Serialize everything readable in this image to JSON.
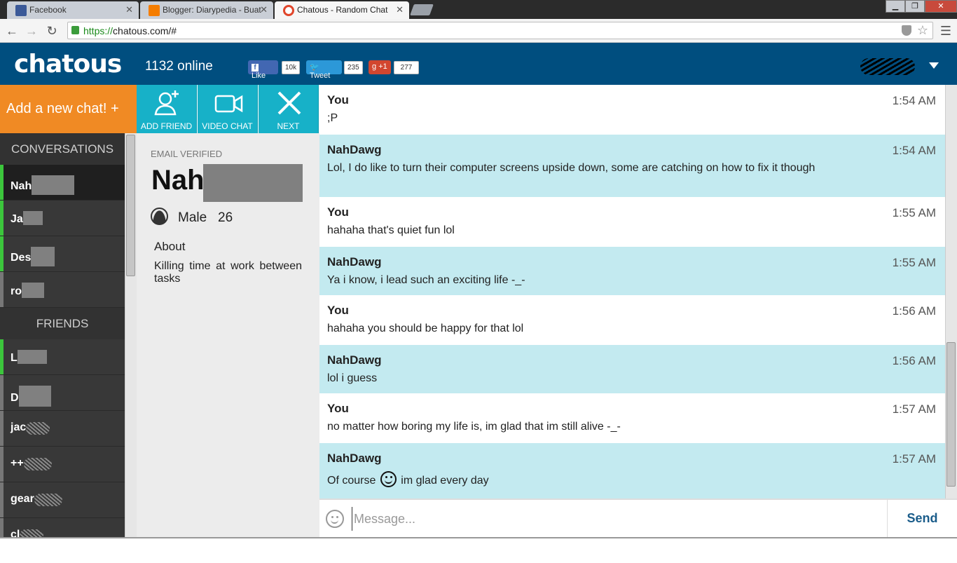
{
  "browser": {
    "tabs": [
      {
        "label": "Facebook",
        "favicon_color": "#3b5998"
      },
      {
        "label": "Blogger: Diarypedia - Buat",
        "favicon_color": "#f57d00"
      },
      {
        "label": "Chatous - Random Chat",
        "favicon_color": "#e0452a",
        "active": true
      }
    ],
    "url_scheme": "https://",
    "url_rest": "chatous.com/#"
  },
  "header": {
    "logo": "chatous",
    "online": "1132 online",
    "like_label": "Like",
    "like_count": "10k",
    "tweet_label": "Tweet",
    "tweet_count": "235",
    "plusone_label": "+1",
    "plusone_count": "277"
  },
  "actions": {
    "add_chat": "Add a new chat! +",
    "add_friend": "ADD FRIEND",
    "video_chat": "VIDEO CHAT",
    "next": "NEXT"
  },
  "sidebar": {
    "conversations_header": "CONVERSATIONS",
    "conversations": [
      {
        "name": "Nah",
        "status": "on",
        "active": true
      },
      {
        "name": "Ja",
        "status": "on"
      },
      {
        "name": "Des",
        "status": "on"
      },
      {
        "name": "ro",
        "status": "off"
      }
    ],
    "friends_header": "FRIENDS",
    "friends": [
      {
        "name": "L",
        "status": "on"
      },
      {
        "name": "D",
        "status": "off"
      },
      {
        "name": "jac",
        "status": "off"
      },
      {
        "name": "++",
        "status": "off"
      },
      {
        "name": "gear",
        "status": "off"
      },
      {
        "name": "cl",
        "status": "off"
      }
    ]
  },
  "profile": {
    "verified": "EMAIL VERIFIED",
    "name": "Nah",
    "gender": "Male",
    "age": "26",
    "about_header": "About",
    "about_text": "Killing time at work between tasks"
  },
  "messages": [
    {
      "from": "You",
      "time": "1:54 AM",
      "text": ";P",
      "side": "me"
    },
    {
      "from": "NahDawg",
      "time": "1:54 AM",
      "text": "Lol, I do like to turn their computer screens upside down, some are catching on how to fix it though",
      "side": "them"
    },
    {
      "from": "You",
      "time": "1:55 AM",
      "text": "hahaha that's quiet fun lol",
      "side": "me"
    },
    {
      "from": "NahDawg",
      "time": "1:55 AM",
      "text": "Ya i know, i lead such an exciting life -_-",
      "side": "them"
    },
    {
      "from": "You",
      "time": "1:56 AM",
      "text": "hahaha you should be happy for that lol",
      "side": "me"
    },
    {
      "from": "NahDawg",
      "time": "1:56 AM",
      "text": "lol i guess",
      "side": "them"
    },
    {
      "from": "You",
      "time": "1:57 AM",
      "text": "no matter how boring my life is, im glad that im still alive -_-",
      "side": "me"
    },
    {
      "from": "NahDawg",
      "time": "1:57 AM",
      "text_before": "Of course",
      "emoji": "smiley-icon",
      "text_after": "im glad every day",
      "side": "them"
    }
  ],
  "composer": {
    "placeholder": "Message...",
    "send": "Send"
  },
  "colors": {
    "header_bg": "#004e7f",
    "add_chat_bg": "#f08a24",
    "action_bg": "#17b1c8",
    "their_message_bg": "#c3eaf0",
    "online_indicator": "#3cc63c"
  }
}
